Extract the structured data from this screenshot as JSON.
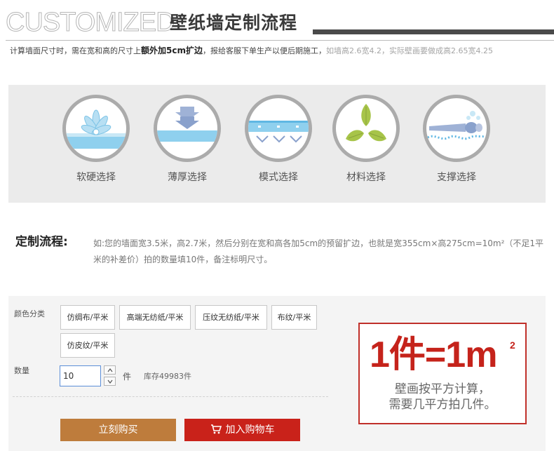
{
  "header": {
    "title_en": "CUSTOMIZED",
    "title_cn": "壁纸墙定制流程"
  },
  "note": {
    "part1": "计算墙面尺寸时，需在宽和高的尺寸上",
    "bold": "额外加5cm扩边",
    "part2": "，报给客服下单生产以便后期施工，",
    "gray": "如墙高2.6宽4.2，实际壁画要做成高2.65宽4.25"
  },
  "options": [
    {
      "icon": "flower-icon",
      "label": "软硬选择"
    },
    {
      "icon": "thickness-arrow-icon",
      "label": "薄厚选择"
    },
    {
      "icon": "pattern-icon",
      "label": "模式选择"
    },
    {
      "icon": "leaves-icon",
      "label": "材料选择"
    },
    {
      "icon": "support-icon",
      "label": "支撑选择"
    }
  ],
  "process": {
    "title": "定制流程:",
    "text": "如:您的墙面宽3.5米，高2.7米，然后分别在宽和高各加5cm的预留扩边，也就是宽355cm×高275cm=10m²（不足1平米的补差价）拍的数量填10件，备注标明尺寸。"
  },
  "purchase": {
    "color_label": "颜色分类",
    "skus": [
      "仿绸布/平米",
      "高端无纺纸/平米",
      "压纹无纺纸/平米",
      "布纹/平米",
      "仿皮纹/平米"
    ],
    "qty_label": "数量",
    "qty_value": "10",
    "unit": "件",
    "stock": "库存49983件",
    "buy_now": "立刻购买",
    "add_cart": "加入购物车"
  },
  "promo": {
    "big": "1件=1m",
    "sup": "2",
    "line1": "壁画按平方计算，",
    "line2": "需要几平方拍几件。"
  },
  "colors": {
    "accent_red": "#c9221a",
    "buy_brown": "#be7c3c",
    "panel_gray": "#ebebeb"
  }
}
